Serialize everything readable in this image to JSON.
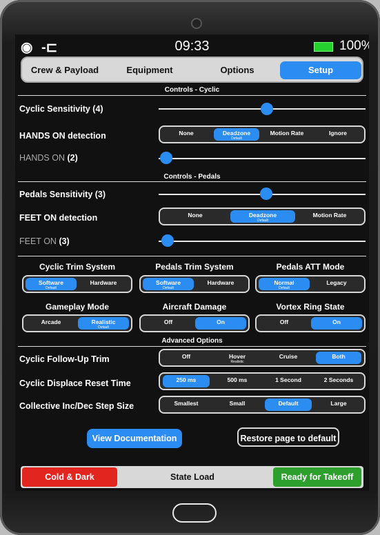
{
  "status": {
    "time": "09:33",
    "battery": "100%",
    "battery_level": 1.0,
    "left_icons": [
      "audio-icon",
      "plug-icon"
    ]
  },
  "tabs": [
    {
      "label": "Crew & Payload"
    },
    {
      "label": "Equipment"
    },
    {
      "label": "Options"
    },
    {
      "label": "Setup",
      "active": true
    }
  ],
  "sections": {
    "cyclic": "Controls - Cyclic",
    "pedals": "Controls - Pedals",
    "advanced": "Advanced Options"
  },
  "cyclic": {
    "sensitivity_label": "Cyclic Sensitivity (4)",
    "sensitivity_value": 4,
    "hands_detection_label": "HANDS ON detection",
    "hands_options": [
      "None",
      "Deadzone",
      "Motion Rate",
      "Ignore"
    ],
    "hands_selected_sub": "Default",
    "hands_on_label": "HANDS ON",
    "hands_on_value": "(2)"
  },
  "pedals": {
    "sensitivity_label": "Pedals Sensitivity (3)",
    "sensitivity_value": 3,
    "feet_detection_label": "FEET ON detection",
    "feet_options": [
      "None",
      "Deadzone",
      "Motion Rate"
    ],
    "feet_selected_sub": "Default",
    "feet_on_label": "FEET ON",
    "feet_on_value": "(3)"
  },
  "trim": {
    "cyclic_trim": {
      "title": "Cyclic Trim System",
      "options": [
        "Software",
        "Hardware"
      ],
      "sub": "Default"
    },
    "pedals_trim": {
      "title": "Pedals Trim System",
      "options": [
        "Software",
        "Hardware"
      ],
      "sub": "Default"
    },
    "pedals_att": {
      "title": "Pedals ATT Mode",
      "options": [
        "Normal",
        "Legacy"
      ],
      "sub": "Default"
    },
    "gameplay": {
      "title": "Gameplay Mode",
      "options": [
        "Arcade",
        "Realistic"
      ],
      "sub": "Default"
    },
    "damage": {
      "title": "Aircraft Damage",
      "options": [
        "Off",
        "On"
      ]
    },
    "vortex": {
      "title": "Vortex Ring State",
      "options": [
        "Off",
        "On"
      ]
    }
  },
  "advanced": {
    "followup": {
      "label": "Cyclic Follow-Up Trim",
      "options": [
        "Off",
        "Hover",
        "Cruise",
        "Both"
      ],
      "hover_sub": "Realistic"
    },
    "displace": {
      "label": "Cyclic Displace Reset Time",
      "options": [
        "250 ms",
        "500 ms",
        "1 Second",
        "2 Seconds"
      ]
    },
    "collective": {
      "label": "Collective Inc/Dec Step Size",
      "options": [
        "Smallest",
        "Small",
        "Default",
        "Large"
      ]
    }
  },
  "buttons": {
    "docs": "View Documentation",
    "restore": "Restore page to default"
  },
  "bottom": {
    "cold": "Cold & Dark",
    "state": "State Load",
    "ready": "Ready for Takeoff"
  },
  "colors": {
    "accent": "#2b8cf2",
    "red": "#e0261f",
    "green": "#2c9f2c"
  }
}
